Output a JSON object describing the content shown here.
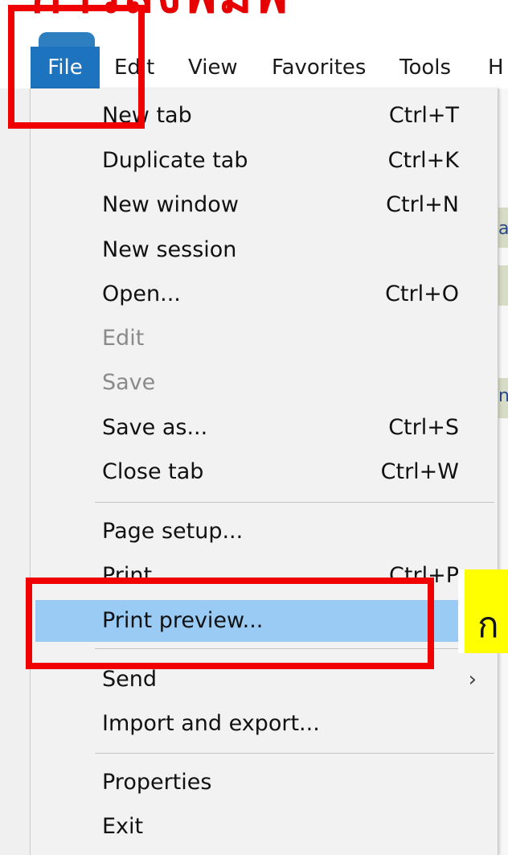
{
  "heading": {
    "text": "การสั่งพิมพ์"
  },
  "menubar": {
    "items": [
      {
        "label": "File",
        "active": true
      },
      {
        "label": "Edit"
      },
      {
        "label": "View"
      },
      {
        "label": "Favorites"
      },
      {
        "label": "Tools"
      },
      {
        "label": "H"
      }
    ]
  },
  "file_menu": {
    "items": [
      {
        "label": "New tab",
        "shortcut": "Ctrl+T"
      },
      {
        "label": "Duplicate tab",
        "shortcut": "Ctrl+K"
      },
      {
        "label": "New window",
        "shortcut": "Ctrl+N"
      },
      {
        "label": "New session",
        "shortcut": ""
      },
      {
        "label": "Open...",
        "shortcut": "Ctrl+O"
      },
      {
        "label": "Edit",
        "shortcut": "",
        "disabled": true
      },
      {
        "label": "Save",
        "shortcut": "",
        "disabled": true
      },
      {
        "label": "Save as...",
        "shortcut": "Ctrl+S"
      },
      {
        "label": "Close tab",
        "shortcut": "Ctrl+W"
      },
      {
        "label": "Page setup...",
        "shortcut": ""
      },
      {
        "label": "Print",
        "shortcut": "Ctrl+P"
      },
      {
        "label": "Print preview...",
        "shortcut": "",
        "highlighted": true
      },
      {
        "label": "Send",
        "shortcut": "",
        "submenu": true
      },
      {
        "label": "Import and export...",
        "shortcut": ""
      },
      {
        "label": "Properties",
        "shortcut": ""
      },
      {
        "label": "Exit",
        "shortcut": ""
      }
    ],
    "submenu_arrow": "›"
  },
  "callout": {
    "text": "ก"
  },
  "right_edge_letters": [
    "a",
    "n"
  ],
  "colors": {
    "annotation_red": "#f00000",
    "menu_highlight": "#99cbf5",
    "menubar_active": "#1e73be",
    "callout_yellow": "#ffff00"
  }
}
